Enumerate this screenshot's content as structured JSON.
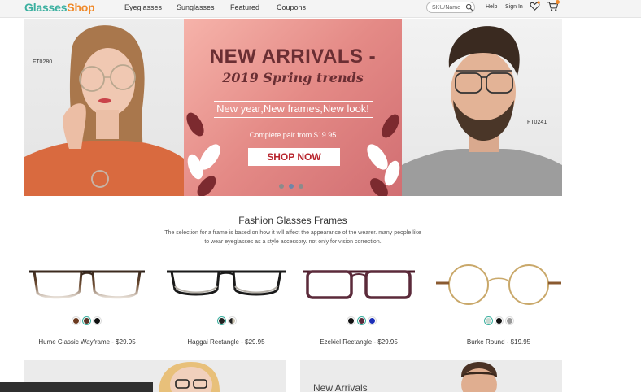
{
  "header": {
    "logo": {
      "part1": "Glasses",
      "part2": "Shop"
    },
    "nav": [
      "Eyeglasses",
      "Sunglasses",
      "Featured",
      "Coupons"
    ],
    "search": {
      "placeholder": "SKU/Name",
      "value": ""
    },
    "help": "Help",
    "signin": "Sign In",
    "icons": [
      "search-icon",
      "heart-icon",
      "cart-icon"
    ],
    "brand_colors": {
      "logo_primary": "#3cb0a0",
      "logo_accent": "#f08a2b"
    }
  },
  "hero": {
    "code_left": "FT0280",
    "code_right": "FT0241",
    "title": "NEW ARRIVALS -",
    "subtitle": "2019 Spring trends",
    "tagline": "New year,New frames,New look!",
    "price_line": "Complete pair from $19.95",
    "cta": "SHOP NOW",
    "slides": 3,
    "active_slide": 2,
    "colors": {
      "title": "#6a2e33",
      "cta_text": "#b8262f",
      "banner": "#e48a86"
    }
  },
  "section": {
    "title": "Fashion Glasses Frames",
    "description_line1": "The selection for a frame is based on how it will affect the appearance of the wearer. many people like",
    "description_line2": "to wear eyeglasses as a style accessory. not only for vision correction."
  },
  "products": [
    {
      "name": "Hume Classic Wayframe - $29.95",
      "swatches": [
        "#6b3a20",
        "#5a3428",
        "#111111"
      ],
      "selected": 1
    },
    {
      "name": "Haggai Rectangle - $29.95",
      "swatches": [
        "#222222",
        "#c9c2b0"
      ],
      "selected": 0
    },
    {
      "name": "Ezekiel Rectangle - $29.95",
      "swatches": [
        "#111111",
        "#5b2a3a",
        "#1c2fb8"
      ],
      "selected": 1
    },
    {
      "name": "Burke Round - $19.95",
      "swatches": [
        "#c8d8d0",
        "#111111",
        "#999999"
      ],
      "selected": 0
    }
  ],
  "bottom": {
    "right_title": "New Arrivals"
  }
}
